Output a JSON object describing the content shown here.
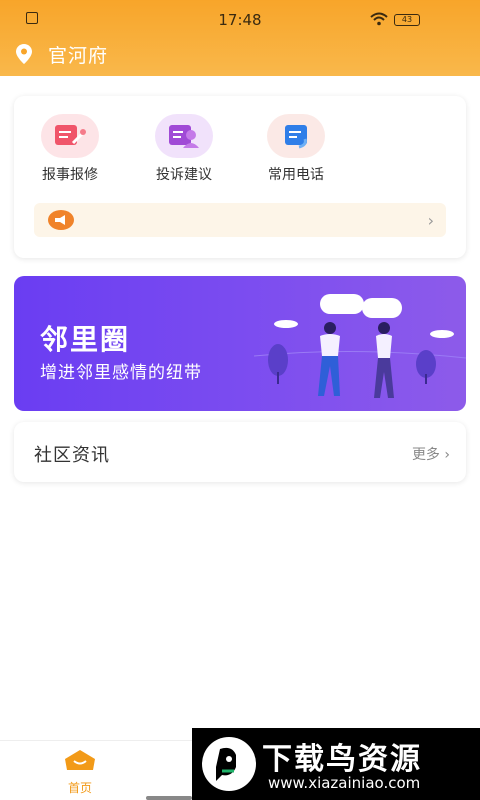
{
  "status_bar": {
    "time": "17:48",
    "battery": "43"
  },
  "header": {
    "location_name": "官河府"
  },
  "services": [
    {
      "label": "报事报修",
      "icon": "repair-icon",
      "color": "#f0556a"
    },
    {
      "label": "投诉建议",
      "icon": "complaint-icon",
      "color": "#a04ad6"
    },
    {
      "label": "常用电话",
      "icon": "phone-book-icon",
      "color": "#2f7ee8"
    }
  ],
  "notice": {
    "icon": "megaphone-icon",
    "arrow": "›"
  },
  "banner": {
    "title": "邻里圈",
    "subtitle": "增进邻里感情的纽带"
  },
  "news": {
    "title": "社区资讯",
    "more": "更多 ›"
  },
  "tabbar": {
    "home_label": "首页"
  },
  "watermark": {
    "title": "下载鸟资源",
    "url": "www.xiazainiao.com"
  },
  "colors": {
    "accent": "#f29a18",
    "header": "#f8a52a",
    "banner": "#7048f0"
  }
}
